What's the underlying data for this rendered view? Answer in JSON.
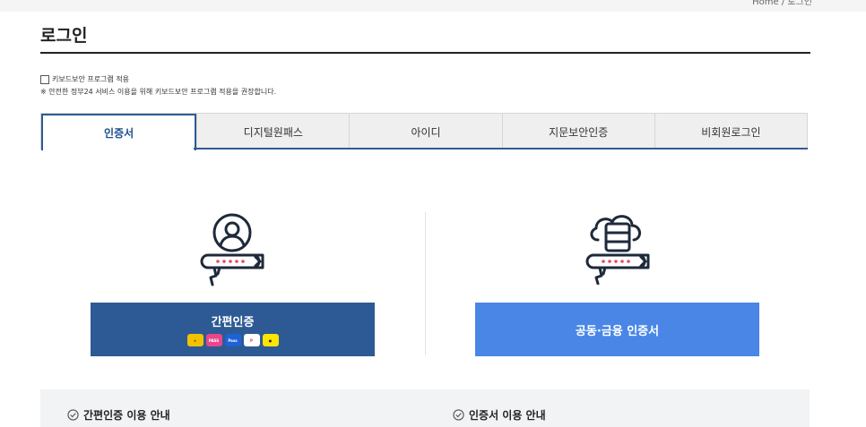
{
  "breadcrumb": {
    "text": "Home / 로그인"
  },
  "page": {
    "title": "로그인"
  },
  "keyboard_security": {
    "checkbox_label": "키보드보안 프로그램 적용",
    "notice": "※ 안전한 정부24 서비스 이용을 위해 키보드보안 프로그램 적용을 권장합니다."
  },
  "tabs": [
    {
      "label": "인증서",
      "active": true
    },
    {
      "label": "디지털원패스",
      "active": false
    },
    {
      "label": "아이디",
      "active": false
    },
    {
      "label": "지문보안인증",
      "active": false
    },
    {
      "label": "비회원로그인",
      "active": false
    }
  ],
  "options": {
    "simple_auth": {
      "label": "간편인증",
      "icon": "user-key-icon",
      "providers": [
        "kb-logo",
        "pass-logo",
        "samsung-pass-logo",
        "payco-logo",
        "kakao-logo"
      ]
    },
    "certificate": {
      "label": "공동·금융 인증서",
      "icon": "cloud-server-key-icon"
    }
  },
  "guide": {
    "simple_auth_title": "간편인증 이용 안내",
    "certificate_title": "인증서 이용 안내"
  },
  "colors": {
    "tab_accent": "#2f5b93",
    "simple_button": "#2d5a94",
    "certificate_button": "#4a86e6"
  }
}
